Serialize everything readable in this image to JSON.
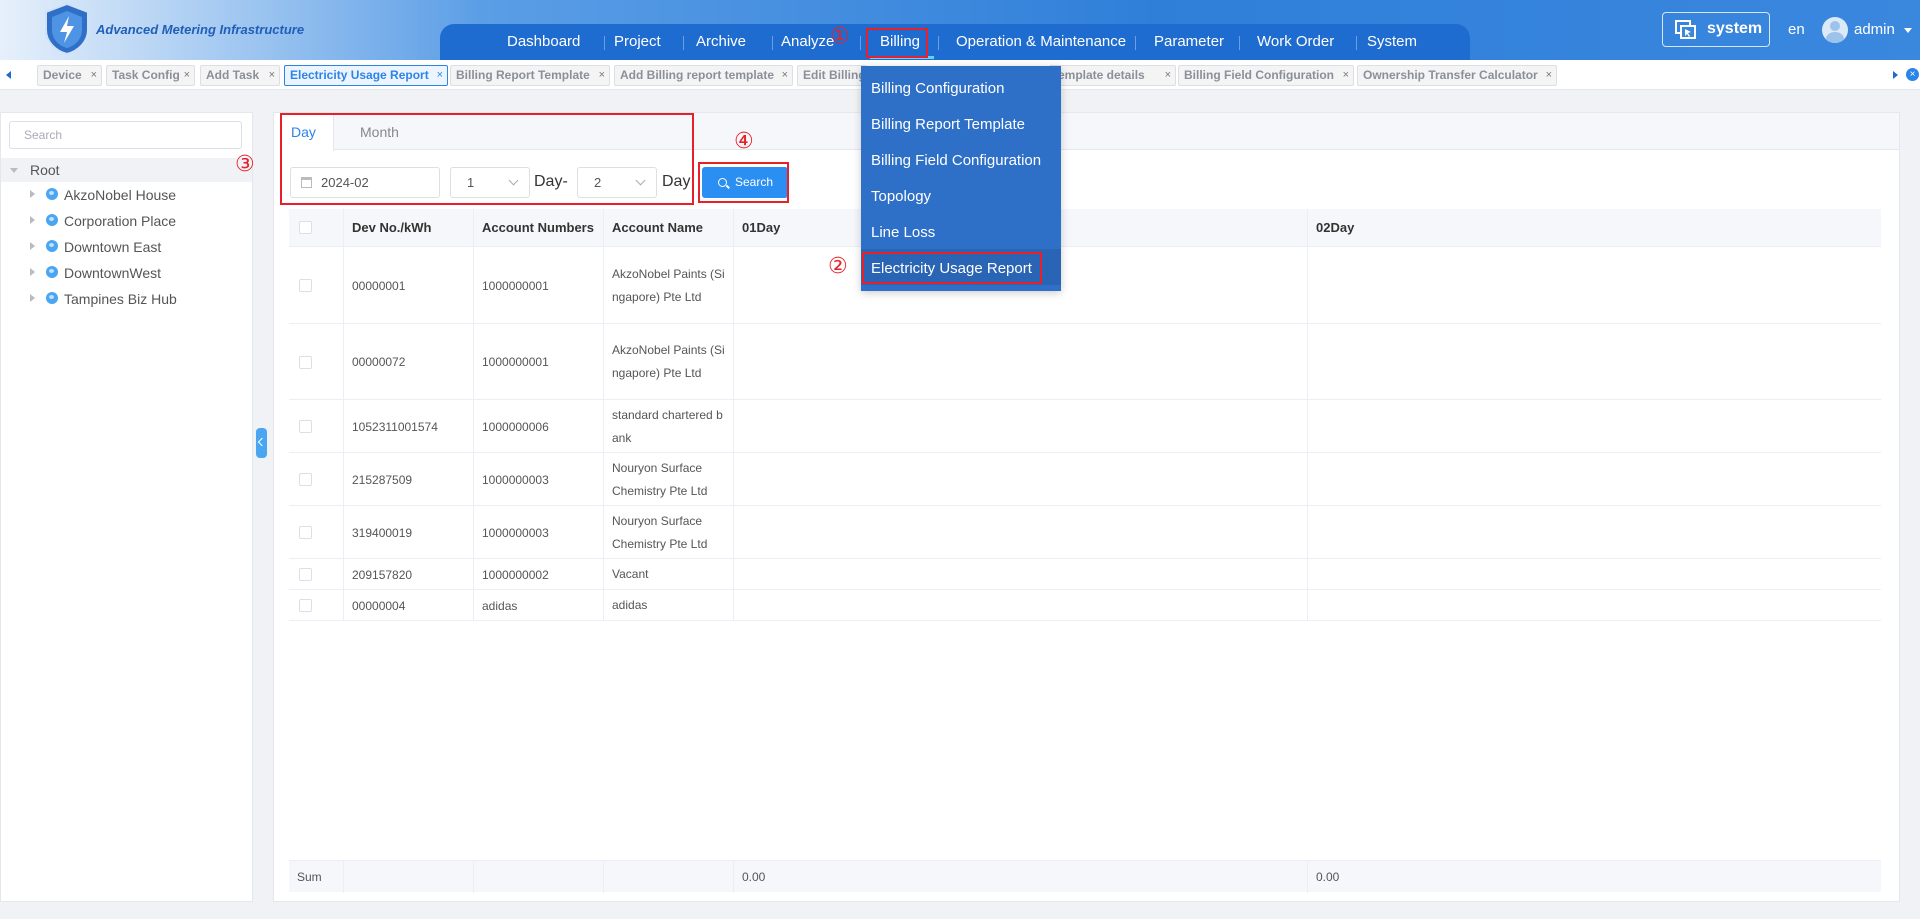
{
  "header": {
    "brand": "Advanced Metering Infrastructure",
    "nav": [
      "Dashboard",
      "Project",
      "Archive",
      "Analyze",
      "Billing",
      "Operation & Maintenance",
      "Parameter",
      "Work Order",
      "System"
    ],
    "system_label": "system",
    "lang": "en",
    "user": "admin"
  },
  "tabs": [
    {
      "label": "Device",
      "active": false
    },
    {
      "label": "Task Config",
      "active": false
    },
    {
      "label": "Add Task",
      "active": false
    },
    {
      "label": "Electricity Usage Report",
      "active": true
    },
    {
      "label": "Billing Report Template",
      "active": false
    },
    {
      "label": "Add Billing report template",
      "active": false
    },
    {
      "label": "Edit Billing",
      "active": false
    },
    {
      "label": "template details",
      "active": false
    },
    {
      "label": "Billing Field Configuration",
      "active": false
    },
    {
      "label": "Ownership Transfer Calculator",
      "active": false
    }
  ],
  "tab_close": "×",
  "tree": {
    "search_placeholder": "Search",
    "root": "Root",
    "children": [
      "AkzoNobel House",
      "Corporation Place",
      "Downtown East",
      "DowntownWest",
      "Tampines Biz Hub"
    ]
  },
  "filter": {
    "tabs": [
      "Day",
      "Month"
    ],
    "date": "2024-02",
    "from_day": "1",
    "from_suffix": "Day-",
    "to_day": "2",
    "to_suffix": "Day",
    "search_label": "Search"
  },
  "table": {
    "headers": [
      "Dev No./kWh",
      "Account Numbers",
      "Account Name",
      "01Day",
      "02Day"
    ],
    "rows": [
      {
        "dev": "00000001",
        "account": "1000000001",
        "name": "AkzoNobel Paints (Singapore) Pte Ltd",
        "d1": "",
        "d2": ""
      },
      {
        "dev": "00000072",
        "account": "1000000001",
        "name": "AkzoNobel Paints (Singapore) Pte Ltd",
        "d1": "",
        "d2": ""
      },
      {
        "dev": "1052311001574",
        "account": "1000000006",
        "name": "standard chartered bank",
        "d1": "",
        "d2": ""
      },
      {
        "dev": "215287509",
        "account": "1000000003",
        "name": "Nouryon Surface Chemistry Pte Ltd",
        "d1": "",
        "d2": ""
      },
      {
        "dev": "319400019",
        "account": "1000000003",
        "name": "Nouryon Surface Chemistry Pte Ltd",
        "d1": "",
        "d2": ""
      },
      {
        "dev": "209157820",
        "account": "1000000002",
        "name": "Vacant",
        "d1": "",
        "d2": ""
      },
      {
        "dev": "00000004",
        "account": "adidas",
        "name": "adidas",
        "d1": "",
        "d2": ""
      }
    ],
    "sum_label": "Sum",
    "sum_d1": "0.00",
    "sum_d2": "0.00"
  },
  "billing_menu": [
    "Billing Configuration",
    "Billing Report Template",
    "Billing Field Configuration",
    "Topology",
    "Line Loss",
    "Electricity Usage Report"
  ],
  "annotations": [
    "①",
    "②",
    "③",
    "④"
  ],
  "colors": {
    "primary": "#2b84e8",
    "nav": "#1f6cd0",
    "annotation": "#e8202a"
  }
}
